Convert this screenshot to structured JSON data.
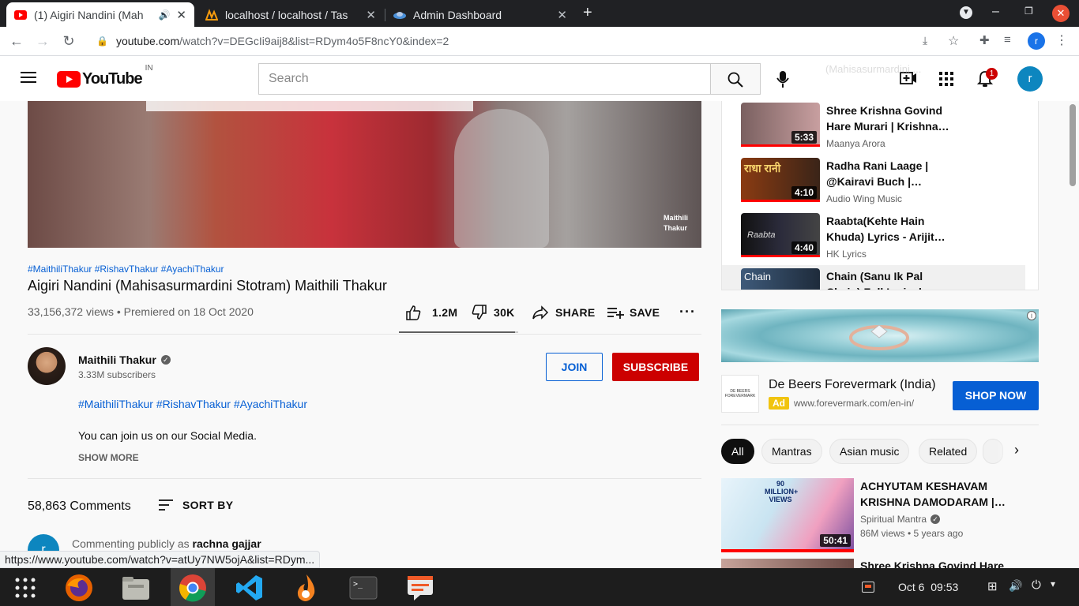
{
  "browser": {
    "tabs": [
      {
        "title": "(1) Aigiri Nandini (Mah",
        "active": true
      },
      {
        "title": "localhost / localhost / Tas",
        "active": false
      },
      {
        "title": "Admin Dashboard",
        "active": false
      }
    ],
    "url": {
      "host": "youtube.com",
      "path": "/watch?v=DEGcIi9aij8&list=RDym4o5F8ncY0&index=2"
    },
    "status_url": "https://www.youtube.com/watch?v=atUy7NW5ojA&list=RDym..."
  },
  "masthead": {
    "logo_text": "YouTube",
    "region": "IN",
    "search_placeholder": "Search",
    "notification_count": "1",
    "avatar_letter": "r"
  },
  "player": {
    "watermark": [
      "Maithili",
      "Thakur"
    ]
  },
  "video": {
    "hashtags": "#MaithiliThakur #RishavThakur #AyachiThakur",
    "title": "Aigiri Nandini (Mahisasurmardini Stotram) Maithili Thakur",
    "meta": "33,156,372 views • Premiered on 18 Oct 2020",
    "likes": "1.2M",
    "dislikes": "30K",
    "like_ratio": 0.976,
    "share_label": "SHARE",
    "save_label": "SAVE"
  },
  "channel": {
    "name": "Maithili Thakur",
    "subscribers": "3.33M subscribers",
    "join_label": "JOIN",
    "subscribe_label": "SUBSCRIBE"
  },
  "description": {
    "hashtags": "#MaithiliThakur #RishavThakur #AyachiThakur",
    "line": "You can join us on our Social Media.",
    "show_more": "SHOW MORE"
  },
  "comments": {
    "count": "58,863 Comments",
    "sort_label": "SORT BY",
    "commenting_as": "Commenting publicly as",
    "user": "rachna gajjar",
    "avatar_letter": "r"
  },
  "playlist": {
    "top_partial": "(Mahisasurmardini ...",
    "items": [
      {
        "title": "Shree Krishna Govind Hare Murari | Krishna…",
        "channel": "Maanya Arora",
        "duration": "5:33"
      },
      {
        "title": "Radha Rani Laage | @Kairavi Buch |…",
        "channel": "Audio Wing Music",
        "duration": "4:10"
      },
      {
        "title": "Raabta(Kehte Hain Khuda) Lyrics - Arijit…",
        "channel": "HK Lyrics",
        "duration": "4:40"
      },
      {
        "title": "Chain (Sanu Ik Pal Chain) Full Lyrical…",
        "channel": "",
        "duration": ""
      }
    ]
  },
  "ad": {
    "brand": "De Beers Forevermark (India)",
    "badge": "Ad",
    "url": "www.forevermark.com/en-in/",
    "cta": "SHOP NOW",
    "logo_text": "DE BEERS FOREVERMARK"
  },
  "chips": [
    "All",
    "Mantras",
    "Asian music",
    "Related"
  ],
  "recommended": [
    {
      "title": "ACHYUTAM KESHAVAM KRISHNA DAMODARAM |…",
      "channel": "Spiritual Mantra",
      "meta": "86M views • 5 years ago",
      "duration": "50:41",
      "thumb_text": "90 MILLION+ VIEWS"
    },
    {
      "title": "Shree Krishna Govind Hare",
      "channel": "",
      "meta": "",
      "duration": ""
    }
  ],
  "taskbar": {
    "date": "Oct 6",
    "time": "09:53"
  },
  "colors": {
    "accent_red": "#cc0000",
    "link_blue": "#065fd4",
    "shop_blue": "#065fd4"
  }
}
